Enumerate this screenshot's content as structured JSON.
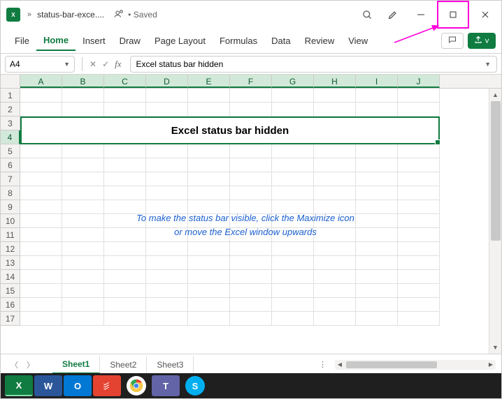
{
  "title": {
    "filename": "status-bar-exce....",
    "saved_label": "Saved"
  },
  "ribbon": {
    "tabs": [
      "File",
      "Home",
      "Insert",
      "Draw",
      "Page Layout",
      "Formulas",
      "Data",
      "Review",
      "View"
    ],
    "active_index": 1
  },
  "formula_bar": {
    "name_box": "A4",
    "formula": "Excel status bar hidden"
  },
  "grid": {
    "columns": [
      "A",
      "B",
      "C",
      "D",
      "E",
      "F",
      "G",
      "H",
      "I",
      "J"
    ],
    "row_count": 17,
    "selected_row": 4,
    "merged_title": "Excel status bar hidden",
    "note_line1": "To make the status bar visible, click the Maximize icon",
    "note_line2": "or move the Excel window upwards"
  },
  "sheets": {
    "tabs": [
      "Sheet1",
      "Sheet2",
      "Sheet3"
    ],
    "active_index": 0
  },
  "taskbar": {
    "apps": [
      "excel",
      "word",
      "outlook",
      "todoist",
      "chrome",
      "teams",
      "skype"
    ]
  },
  "annotation": {
    "highlight": "maximize-button",
    "color": "#ff00dd"
  }
}
